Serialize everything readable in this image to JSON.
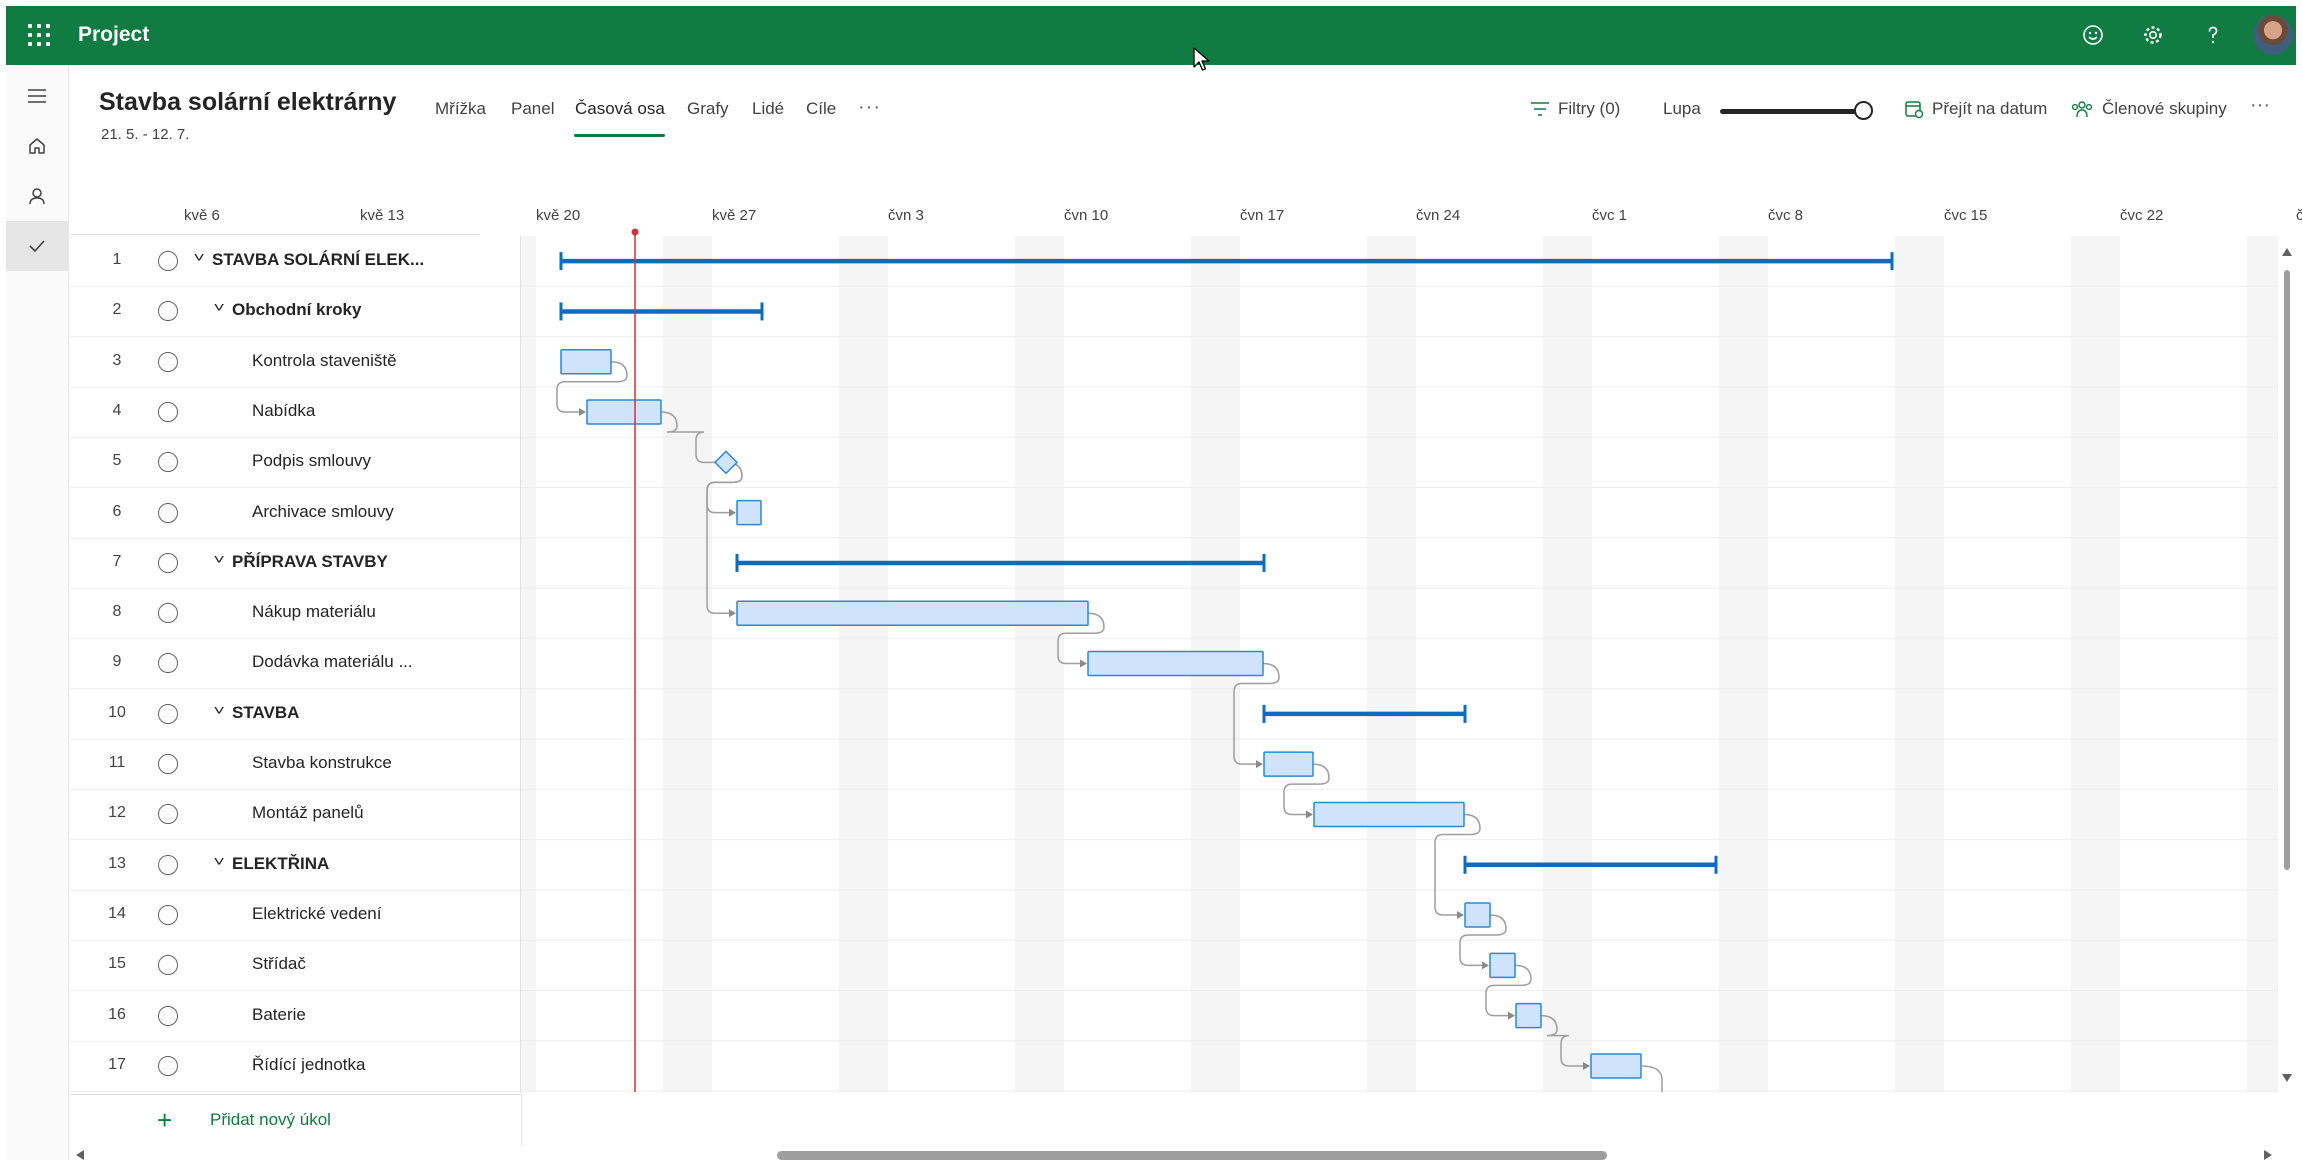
{
  "header": {
    "app_name": "Project",
    "icons": [
      "waffle-icon",
      "smiley-icon",
      "gear-icon",
      "help-icon",
      "avatar"
    ]
  },
  "rail": {
    "items": [
      "hamburger-icon",
      "home-icon",
      "person-icon",
      "checkmark-icon"
    ]
  },
  "project": {
    "title": "Stavba solární elektrárny",
    "dates": "21. 5. - 12. 7."
  },
  "tabs": [
    {
      "label": "Mřížka"
    },
    {
      "label": "Panel"
    },
    {
      "label": "Časová osa",
      "active": true
    },
    {
      "label": "Grafy"
    },
    {
      "label": "Lidé"
    },
    {
      "label": "Cíle"
    }
  ],
  "tab_more": "···",
  "commands": {
    "filters": "Filtry (0)",
    "zoom": "Lupa",
    "zoom_level": 1.0,
    "goto_date": "Přejít na datum",
    "member_groups": "Členové skupiny",
    "more": "···"
  },
  "timeline": {
    "weeks": [
      "kvě 6",
      "kvě 13",
      "kvě 20",
      "kvě 27",
      "čvn 3",
      "čvn 10",
      "čvn 17",
      "čvn 24",
      "čvc 1",
      "čvc 8",
      "čvc 15",
      "čvc 22",
      "č"
    ]
  },
  "tasks": [
    {
      "id": "1",
      "name": "STAVBA SOLÁRNÍ ELEK...",
      "level": 0,
      "summary": true
    },
    {
      "id": "2",
      "name": "Obchodní kroky",
      "level": 1,
      "summary": true
    },
    {
      "id": "3",
      "name": "Kontrola staveniště",
      "level": 2
    },
    {
      "id": "4",
      "name": "Nabídka",
      "level": 2
    },
    {
      "id": "5",
      "name": "Podpis smlouvy",
      "level": 2
    },
    {
      "id": "6",
      "name": "Archivace smlouvy",
      "level": 2
    },
    {
      "id": "7",
      "name": "PŘÍPRAVA STAVBY",
      "level": 1,
      "summary": true
    },
    {
      "id": "8",
      "name": "Nákup materiálu",
      "level": 2
    },
    {
      "id": "9",
      "name": "Dodávka materiálu ...",
      "level": 2
    },
    {
      "id": "10",
      "name": "STAVBA",
      "level": 1,
      "summary": true
    },
    {
      "id": "11",
      "name": "Stavba konstrukce",
      "level": 2
    },
    {
      "id": "12",
      "name": "Montáž panelů",
      "level": 2
    },
    {
      "id": "13",
      "name": "ELEKTŘINA",
      "level": 1,
      "summary": true
    },
    {
      "id": "14",
      "name": "Elektrické vedení",
      "level": 2
    },
    {
      "id": "15",
      "name": "Střídač",
      "level": 2
    },
    {
      "id": "16",
      "name": "Baterie",
      "level": 2
    },
    {
      "id": "17",
      "name": "Řídící jednotka",
      "level": 2
    }
  ],
  "add_task": {
    "label": "Přidat nový úkol"
  },
  "colors": {
    "brand": "#107c41",
    "summary_bar": "#0f6cbd",
    "task_fill": "#cfe4fa",
    "task_border": "#2b88d8",
    "today_line": "#d13438"
  }
}
